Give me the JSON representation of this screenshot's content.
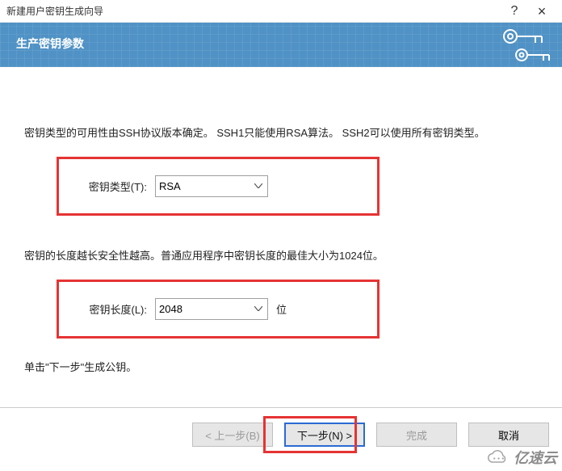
{
  "window": {
    "title": "新建用户密钥生成向导",
    "help_symbol": "?",
    "close_symbol": "×"
  },
  "banner": {
    "heading": "生产密钥参数"
  },
  "content": {
    "key_type_desc": "密钥类型的可用性由SSH协议版本确定。 SSH1只能使用RSA算法。 SSH2可以使用所有密钥类型。",
    "key_type_label": "密钥类型(T):",
    "key_type_value": "RSA",
    "key_length_desc": "密钥的长度越长安全性越高。普通应用程序中密钥长度的最佳大小为1024位。",
    "key_length_label": "密钥长度(L):",
    "key_length_value": "2048",
    "key_length_unit": "位",
    "generate_hint": "单击\"下一步\"生成公钥。"
  },
  "buttons": {
    "prev": "< 上一步(B)",
    "next": "下一步(N) >",
    "finish": "完成",
    "cancel": "取消"
  },
  "watermark": {
    "text": "亿速云"
  }
}
